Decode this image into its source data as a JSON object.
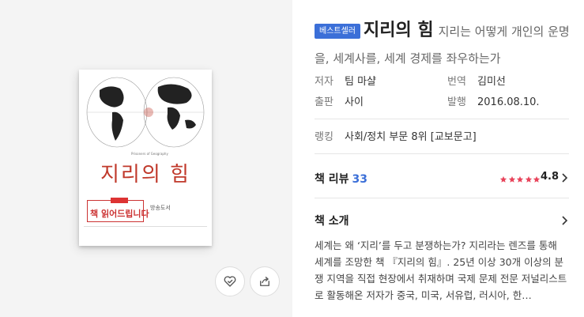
{
  "book": {
    "cover_title": "지리의 힘",
    "cover_banner": "책 읽어드립니다",
    "cover_side": "방송도서"
  },
  "badge": "베스트셀러",
  "title": "지리의 힘",
  "subtitle": "지리는 어떻게 개인의 운명을, 세계사를, 세계 경제를 좌우하는가",
  "meta": {
    "author_label": "저자",
    "author": "팀 마샬",
    "translator_label": "번역",
    "translator": "김미선",
    "publisher_label": "출판",
    "publisher": "사이",
    "date_label": "발행",
    "date": "2016.08.10."
  },
  "rank": {
    "label": "랭킹",
    "value": "사회/정치 부문 8위 [교보문고]"
  },
  "review": {
    "title": "책 리뷰",
    "count": "33",
    "rating": "4.8",
    "stars": 5,
    "star_color": "#e8435a"
  },
  "intro": {
    "title": "책 소개",
    "text": "세계는 왜 ‘지리’를 두고 분쟁하는가? 지리라는 렌즈를 통해 세계를 조망한 책 『지리의 힘』. 25년 이상 30개 이상의 분쟁 지역을 직접 현장에서 취재하며 국제 문제 전문 저널리스트로 활동해온 저자가 중국, 미국, 서유럽, 러시아, 한…"
  },
  "icons": {
    "like": "heart-check-icon",
    "share": "share-icon"
  }
}
